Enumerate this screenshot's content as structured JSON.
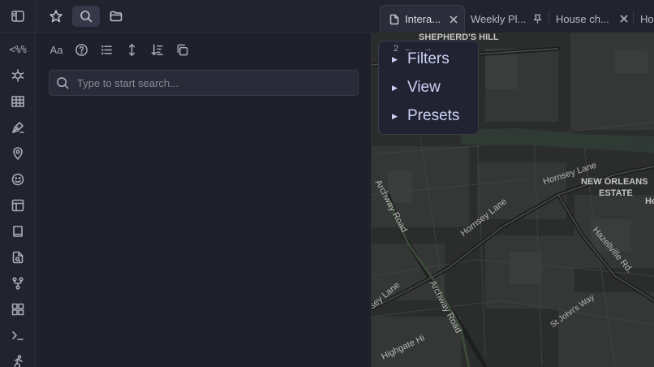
{
  "ribbon": {
    "items": [
      {
        "name": "templater-icon",
        "text": "<%"
      },
      {
        "name": "graph-spider-icon"
      },
      {
        "name": "table-icon"
      },
      {
        "name": "pen-tool-icon"
      },
      {
        "name": "map-pin-icon"
      },
      {
        "name": "smiley-icon"
      },
      {
        "name": "layout-icon"
      },
      {
        "name": "book-icon"
      },
      {
        "name": "file-search-icon"
      },
      {
        "name": "git-fork-icon"
      },
      {
        "name": "dashboard-icon"
      },
      {
        "name": "terminal-icon"
      },
      {
        "name": "running-person-icon"
      }
    ]
  },
  "search": {
    "placeholder": "Type to start search...",
    "value": ""
  },
  "tabs": [
    {
      "label": "Intera...",
      "active": true
    },
    {
      "label": "Weekly Pl...",
      "pinned": true
    },
    {
      "label": "House ch..."
    },
    {
      "label": "Ho"
    }
  ],
  "map": {
    "overlay": {
      "page": "2",
      "back": "←",
      "forward": "→",
      "items": [
        "Filters",
        "View",
        "Presets"
      ]
    },
    "labels": {
      "shepherds_hill": "SHEPHERD'S HILL",
      "new_orleans_1": "NEW ORLEANS",
      "new_orleans_2": "ESTATE",
      "hornsey_lane_1": "Hornsey Lane",
      "hornsey_lane_2": "Hornsey Lane",
      "hornsey_lane_3": "sey Lane",
      "archway_road_1": "Archway Road",
      "archway_road_2": "Archway Road",
      "hazellville": "Hazellville Rd.",
      "st_johns": "St John's Way",
      "highgate": "Highgate Hi",
      "ho_edge": "Ho"
    }
  },
  "colors": {
    "background": "#1e1f2b",
    "accent": "#cdd2f5",
    "map_background": "#2b2d2c"
  }
}
